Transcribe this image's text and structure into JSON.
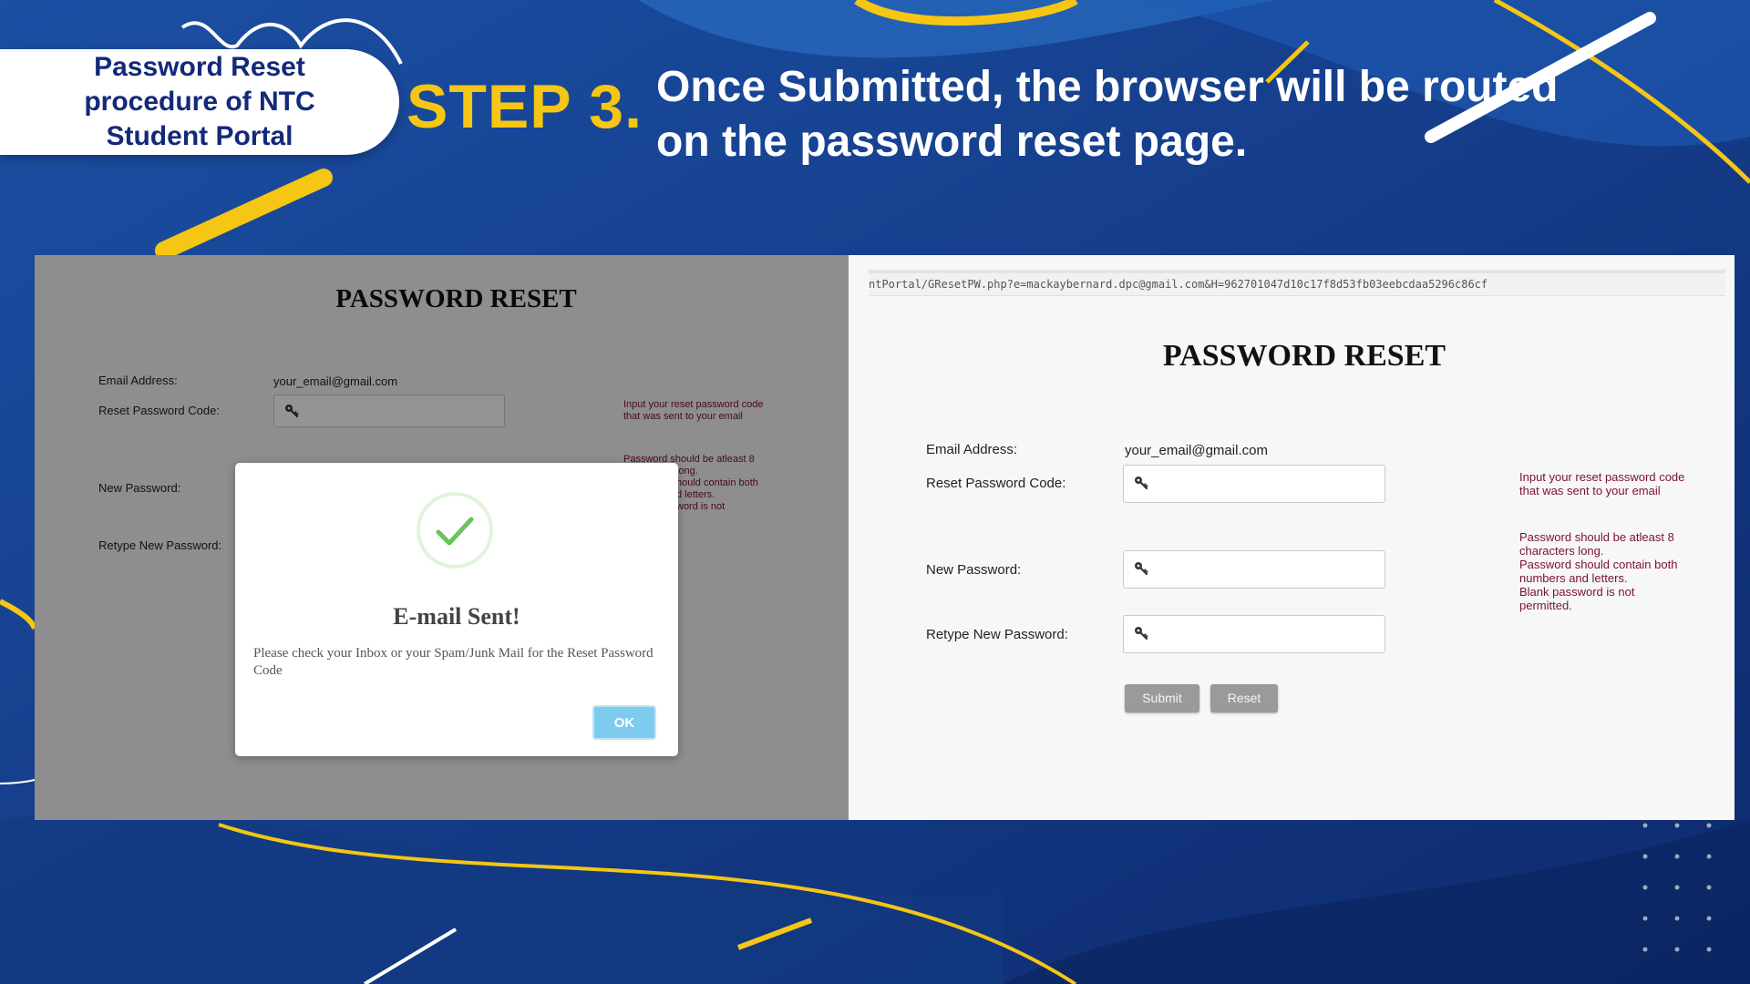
{
  "slide": {
    "badge_lines": [
      "Password Reset",
      "procedure of NTC",
      "Student Portal"
    ],
    "step_label": "STEP 3.",
    "headline_lines": [
      "Once Submitted, the browser will be routed",
      "on the password reset page."
    ]
  },
  "left_screen": {
    "title": "PASSWORD RESET",
    "email_label": "Email Address:",
    "email_value": "your_email@gmail.com",
    "code_label": "Reset Password Code:",
    "new_password_label": "New Password:",
    "retype_label": "Retype New Password:",
    "code_hint": [
      "Input your reset password code",
      "that was sent to your email"
    ],
    "password_hint": [
      "Password should be atleast 8",
      "long.",
      "hould contain both",
      "d letters.",
      "word is not"
    ],
    "modal": {
      "title": "E-mail Sent!",
      "message": "Please check your Inbox or your Spam/Junk Mail for the Reset Password Code",
      "ok_label": "OK"
    }
  },
  "right_screen": {
    "url": "ntPortal/GResetPW.php?e=mackaybernard.dpc@gmail.com&H=962701047d10c17f8d53fb03eebcdaa5296c86cf",
    "title": "PASSWORD RESET",
    "email_label": "Email Address:",
    "email_value": "your_email@gmail.com",
    "code_label": "Reset Password Code:",
    "new_password_label": "New Password:",
    "retype_label": "Retype New Password:",
    "code_hint": [
      "Input your reset password code",
      "that was sent to your email"
    ],
    "password_hint": [
      "Password should be atleast 8",
      "characters long.",
      "Password should contain both",
      "numbers and letters.",
      "Blank password is not",
      "permitted."
    ],
    "submit_label": "Submit",
    "reset_label": "Reset"
  },
  "icons": {
    "field": "key-icon",
    "modal": "checkmark-icon"
  },
  "colors": {
    "accent_yellow": "#f5c613",
    "navy": "#13297a",
    "hint": "#7a1230",
    "ok_button": "#7ecbf0",
    "check": "#6cc35a"
  }
}
